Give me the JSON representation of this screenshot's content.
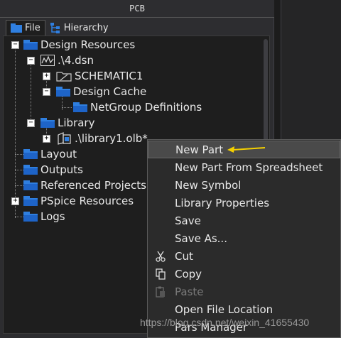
{
  "panel": {
    "title": "PCB"
  },
  "tabs": [
    {
      "label": "File",
      "icon": "folder-icon",
      "active": true
    },
    {
      "label": "Hierarchy",
      "icon": "hierarchy-icon",
      "active": false
    }
  ],
  "tree": {
    "design_resources": "Design Resources",
    "dsn": ".\\4.dsn",
    "schematic": "SCHEMATIC1",
    "design_cache": "Design Cache",
    "netgroup": "NetGroup Definitions",
    "library": "Library",
    "library_olb": ".\\library1.olb*",
    "layout": "Layout",
    "outputs": "Outputs",
    "referenced": "Referenced Projects",
    "pspice": "PSpice Resources",
    "logs": "Logs"
  },
  "context_menu": {
    "items": [
      {
        "label": "New Part",
        "highlighted": true
      },
      {
        "label": "New Part From Spreadsheet"
      },
      {
        "label": "New Symbol"
      },
      {
        "label": "Library Properties"
      },
      {
        "label": "Save"
      },
      {
        "label": "Save As..."
      },
      {
        "label": "Cut",
        "icon": "scissors-icon"
      },
      {
        "label": "Copy",
        "icon": "copy-icon"
      },
      {
        "label": "Paste",
        "icon": "paste-icon",
        "disabled": true
      },
      {
        "label": "Open File Location"
      },
      {
        "label": "Pars Manager"
      }
    ]
  },
  "watermark": "https://blog.csdn.net/weixin_41655430",
  "colors": {
    "folder": "#2f7fe0",
    "arrow": "#f5d000",
    "highlight": "#4a4a4a"
  }
}
